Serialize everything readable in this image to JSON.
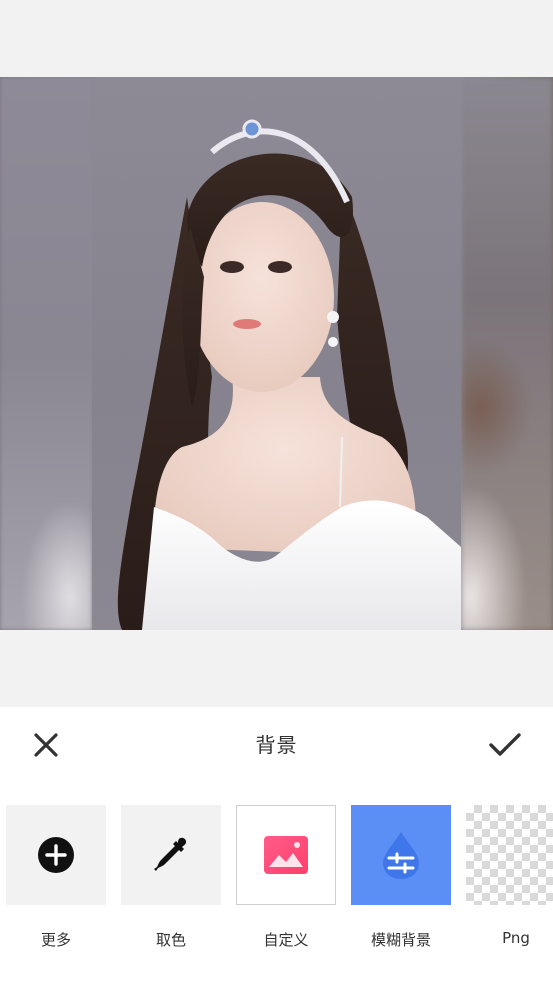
{
  "editor": {
    "title": "背景",
    "close_icon": "close-icon",
    "confirm_icon": "check-icon",
    "accent_color": "#5b8ff5"
  },
  "background_options": [
    {
      "label": "更多",
      "icon": "plus-circle-icon",
      "state": "normal"
    },
    {
      "label": "取色",
      "icon": "eyedropper-icon",
      "state": "normal"
    },
    {
      "label": "自定义",
      "icon": "image-icon",
      "state": "normal"
    },
    {
      "label": "模糊背景",
      "icon": "blur-drop-icon",
      "state": "selected"
    },
    {
      "label": "Png",
      "icon": "transparent-checker",
      "state": "normal"
    }
  ]
}
